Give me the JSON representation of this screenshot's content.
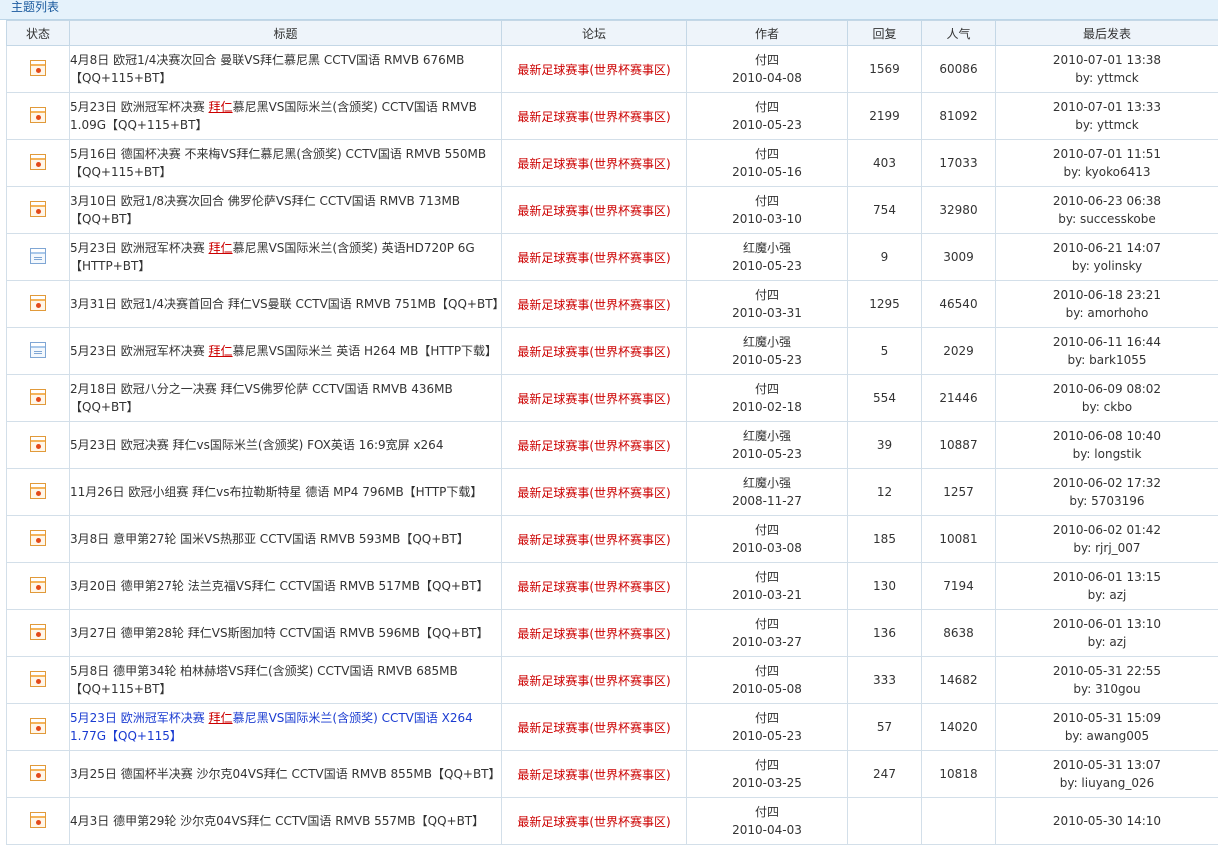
{
  "header": {
    "title": "主题列表"
  },
  "columns": {
    "status": "状态",
    "title": "标题",
    "forum": "论坛",
    "author": "作者",
    "replies": "回复",
    "views": "人气",
    "last_post": "最后发表"
  },
  "threads": [
    {
      "icon": "hot-topic-icon",
      "title": "4月8日 欧冠1/4决赛次回合 曼联VS拜仁慕尼黑 CCTV国语 RMVB 676MB【QQ+115+BT】",
      "highlight": false,
      "forum": "最新足球赛事(世界杯赛事区)",
      "author": "付四",
      "date": "2010-04-08",
      "replies": "1569",
      "views": "60086",
      "last_time": "2010-07-01 13:38",
      "last_by": "by: yttmck"
    },
    {
      "icon": "hot-topic-icon",
      "title_pre": "5月23日 欧洲冠军杯决赛 ",
      "title_kw": "拜仁",
      "title_post": "慕尼黑VS国际米兰(含颁奖) CCTV国语 RMVB 1.09G【QQ+115+BT】",
      "highlight": false,
      "forum": "最新足球赛事(世界杯赛事区)",
      "author": "付四",
      "date": "2010-05-23",
      "replies": "2199",
      "views": "81092",
      "last_time": "2010-07-01 13:33",
      "last_by": "by: yttmck"
    },
    {
      "icon": "hot-topic-icon",
      "title": "5月16日 德国杯决赛 不来梅VS拜仁慕尼黑(含颁奖) CCTV国语 RMVB 550MB【QQ+115+BT】",
      "highlight": false,
      "forum": "最新足球赛事(世界杯赛事区)",
      "author": "付四",
      "date": "2010-05-16",
      "replies": "403",
      "views": "17033",
      "last_time": "2010-07-01 11:51",
      "last_by": "by: kyoko6413"
    },
    {
      "icon": "hot-topic-icon",
      "title": "3月10日 欧冠1/8决赛次回合 佛罗伦萨VS拜仁 CCTV国语 RMVB 713MB【QQ+BT】",
      "highlight": false,
      "forum": "最新足球赛事(世界杯赛事区)",
      "author": "付四",
      "date": "2010-03-10",
      "replies": "754",
      "views": "32980",
      "last_time": "2010-06-23 06:38",
      "last_by": "by: successkobe"
    },
    {
      "icon": "topic-icon",
      "title_pre": "5月23日 欧洲冠军杯决赛 ",
      "title_kw": "拜仁",
      "title_post": "慕尼黑VS国际米兰(含颁奖) 英语HD720P 6G【HTTP+BT】",
      "highlight": false,
      "forum": "最新足球赛事(世界杯赛事区)",
      "author": "红魔小强",
      "date": "2010-05-23",
      "replies": "9",
      "views": "3009",
      "last_time": "2010-06-21 14:07",
      "last_by": "by: yolinsky"
    },
    {
      "icon": "hot-topic-icon",
      "title": "3月31日 欧冠1/4决赛首回合 拜仁VS曼联 CCTV国语 RMVB 751MB【QQ+BT】",
      "highlight": false,
      "forum": "最新足球赛事(世界杯赛事区)",
      "author": "付四",
      "date": "2010-03-31",
      "replies": "1295",
      "views": "46540",
      "last_time": "2010-06-18 23:21",
      "last_by": "by: amorhoho"
    },
    {
      "icon": "topic-icon",
      "title_pre": "5月23日 欧洲冠军杯决赛 ",
      "title_kw": "拜仁",
      "title_post": "慕尼黑VS国际米兰 英语 H264 MB【HTTP下载】",
      "highlight": false,
      "forum": "最新足球赛事(世界杯赛事区)",
      "author": "红魔小强",
      "date": "2010-05-23",
      "replies": "5",
      "views": "2029",
      "last_time": "2010-06-11 16:44",
      "last_by": "by: bark1055"
    },
    {
      "icon": "hot-topic-icon",
      "title": "2月18日 欧冠八分之一决赛 拜仁VS佛罗伦萨 CCTV国语 RMVB 436MB【QQ+BT】",
      "highlight": false,
      "forum": "最新足球赛事(世界杯赛事区)",
      "author": "付四",
      "date": "2010-02-18",
      "replies": "554",
      "views": "21446",
      "last_time": "2010-06-09 08:02",
      "last_by": "by: ckbo"
    },
    {
      "icon": "hot-topic-icon",
      "title": "5月23日 欧冠决赛 拜仁vs国际米兰(含颁奖) FOX英语 16:9宽屏 x264",
      "highlight": false,
      "forum": "最新足球赛事(世界杯赛事区)",
      "author": "红魔小强",
      "date": "2010-05-23",
      "replies": "39",
      "views": "10887",
      "last_time": "2010-06-08 10:40",
      "last_by": "by: longstik"
    },
    {
      "icon": "hot-topic-icon",
      "title": "11月26日 欧冠小组赛 拜仁vs布拉勒斯特星 德语 MP4 796MB【HTTP下载】",
      "highlight": false,
      "forum": "最新足球赛事(世界杯赛事区)",
      "author": "红魔小强",
      "date": "2008-11-27",
      "replies": "12",
      "views": "1257",
      "last_time": "2010-06-02 17:32",
      "last_by": "by: 5703196"
    },
    {
      "icon": "hot-topic-icon",
      "title": "3月8日 意甲第27轮 国米VS热那亚 CCTV国语 RMVB 593MB【QQ+BT】",
      "highlight": false,
      "forum": "最新足球赛事(世界杯赛事区)",
      "author": "付四",
      "date": "2010-03-08",
      "replies": "185",
      "views": "10081",
      "last_time": "2010-06-02 01:42",
      "last_by": "by: rjrj_007"
    },
    {
      "icon": "hot-topic-icon",
      "title": "3月20日 德甲第27轮 法兰克福VS拜仁 CCTV国语 RMVB 517MB【QQ+BT】",
      "highlight": false,
      "forum": "最新足球赛事(世界杯赛事区)",
      "author": "付四",
      "date": "2010-03-21",
      "replies": "130",
      "views": "7194",
      "last_time": "2010-06-01 13:15",
      "last_by": "by: azj"
    },
    {
      "icon": "hot-topic-icon",
      "title": "3月27日 德甲第28轮 拜仁VS斯图加特 CCTV国语 RMVB 596MB【QQ+BT】",
      "highlight": false,
      "forum": "最新足球赛事(世界杯赛事区)",
      "author": "付四",
      "date": "2010-03-27",
      "replies": "136",
      "views": "8638",
      "last_time": "2010-06-01 13:10",
      "last_by": "by: azj"
    },
    {
      "icon": "hot-topic-icon",
      "title": "5月8日 德甲第34轮 柏林赫塔VS拜仁(含颁奖) CCTV国语 RMVB 685MB【QQ+115+BT】",
      "highlight": false,
      "forum": "最新足球赛事(世界杯赛事区)",
      "author": "付四",
      "date": "2010-05-08",
      "replies": "333",
      "views": "14682",
      "last_time": "2010-05-31 22:55",
      "last_by": "by: 310gou"
    },
    {
      "icon": "hot-topic-icon",
      "title_pre": "5月23日 欧洲冠军杯决赛 ",
      "title_kw": "拜仁",
      "title_post": "慕尼黑VS国际米兰(含颁奖) CCTV国语 X264 1.77G【QQ+115】",
      "highlight": true,
      "forum": "最新足球赛事(世界杯赛事区)",
      "author": "付四",
      "date": "2010-05-23",
      "replies": "57",
      "views": "14020",
      "last_time": "2010-05-31 15:09",
      "last_by": "by: awang005"
    },
    {
      "icon": "hot-topic-icon",
      "title": "3月25日 德国杯半决赛 沙尔克04VS拜仁 CCTV国语 RMVB 855MB【QQ+BT】",
      "highlight": false,
      "forum": "最新足球赛事(世界杯赛事区)",
      "author": "付四",
      "date": "2010-03-25",
      "replies": "247",
      "views": "10818",
      "last_time": "2010-05-31 13:07",
      "last_by": "by: liuyang_026"
    },
    {
      "icon": "hot-topic-icon",
      "title": "4月3日 德甲第29轮 沙尔克04VS拜仁 CCTV国语 RMVB 557MB【QQ+BT】",
      "highlight": false,
      "forum": "最新足球赛事(世界杯赛事区)",
      "author": "付四",
      "date": "2010-04-03",
      "replies": "",
      "views": "",
      "last_time": "2010-05-30 14:10",
      "last_by": ""
    }
  ]
}
